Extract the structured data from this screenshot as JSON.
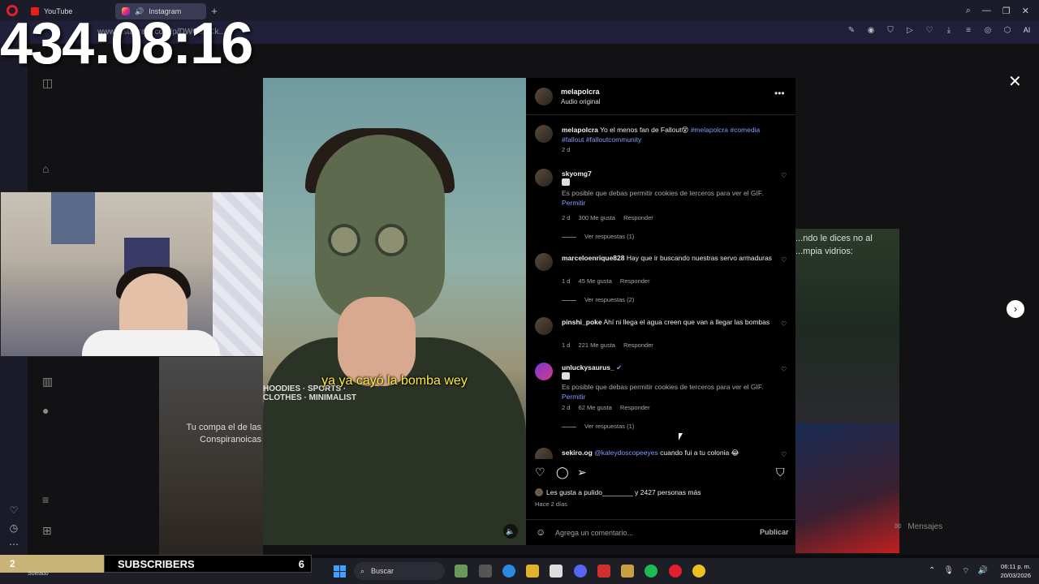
{
  "tabs": [
    {
      "label": "YouTube",
      "icon": "youtube-icon"
    },
    {
      "label": "Instagram",
      "icon": "instagram-icon"
    }
  ],
  "address": {
    "url": "www.instagram.com/p/DWC8HCk..."
  },
  "toolbar": {
    "ai_label": "AI"
  },
  "timer": "434:08:16",
  "post": {
    "username": "melapolcra",
    "audio": "Audio original",
    "subtitle": "ya ya cayó la bomba wey",
    "brand_text": "HOODIES · SPORTS · CLOTHES · MINIMALIST",
    "caption": {
      "user": "melapolcra",
      "text": "Yo el menos fan de Fallout😵",
      "tags": "#melapolcra #comedia #fallout #falloutcommunity",
      "time": "2 d"
    },
    "comments": [
      {
        "user": "skyomg7",
        "text": "",
        "gif_note": "Es posible que debas permitir cookies de terceros para ver el GIF.",
        "permit": "Permitir",
        "time": "2 d",
        "likes": "300 Me gusta",
        "reply": "Responder",
        "view_replies": "Ver respuestas (1)"
      },
      {
        "user": "marceloenrique828",
        "text": "Hay que ir buscando nuestras servo armaduras",
        "time": "1 d",
        "likes": "45 Me gusta",
        "reply": "Responder",
        "view_replies": "Ver respuestas (2)"
      },
      {
        "user": "pinshi_poke",
        "text": "Ahí ni llega el agua creen que van a llegar las bombas",
        "time": "1 d",
        "likes": "221 Me gusta",
        "reply": "Responder"
      },
      {
        "user": "unluckysaurus_",
        "text": "",
        "gif_note": "Es posible que debas permitir cookies de terceros para ver el GIF.",
        "permit": "Permitir",
        "time": "2 d",
        "likes": "62 Me gusta",
        "reply": "Responder",
        "view_replies": "Ver respuestas (1)"
      },
      {
        "user": "sekiro.og",
        "mention": "@kaleydoscopeeyes",
        "text": "cuando fui a tu colonia 😂"
      }
    ],
    "likes_text": "Les gusta a pulido________ y 2427 personas más",
    "posted": "Hace 2 días",
    "comment_placeholder": "Agrega un comentario...",
    "publish": "Publicar"
  },
  "background": {
    "right_caption": "...ndo le dices no al ...mpia vidrios:",
    "left_caption": "Tu compa el de las Conspiranoicas",
    "messages": "Mensajes"
  },
  "stream": {
    "subs_count": "2",
    "subs_label": "SUBSCRIBERS",
    "subs_goal": "6",
    "weather": "Soleado"
  },
  "taskbar": {
    "search": "Buscar",
    "time": "06:11 p. m.",
    "date": "20/03/2026"
  }
}
